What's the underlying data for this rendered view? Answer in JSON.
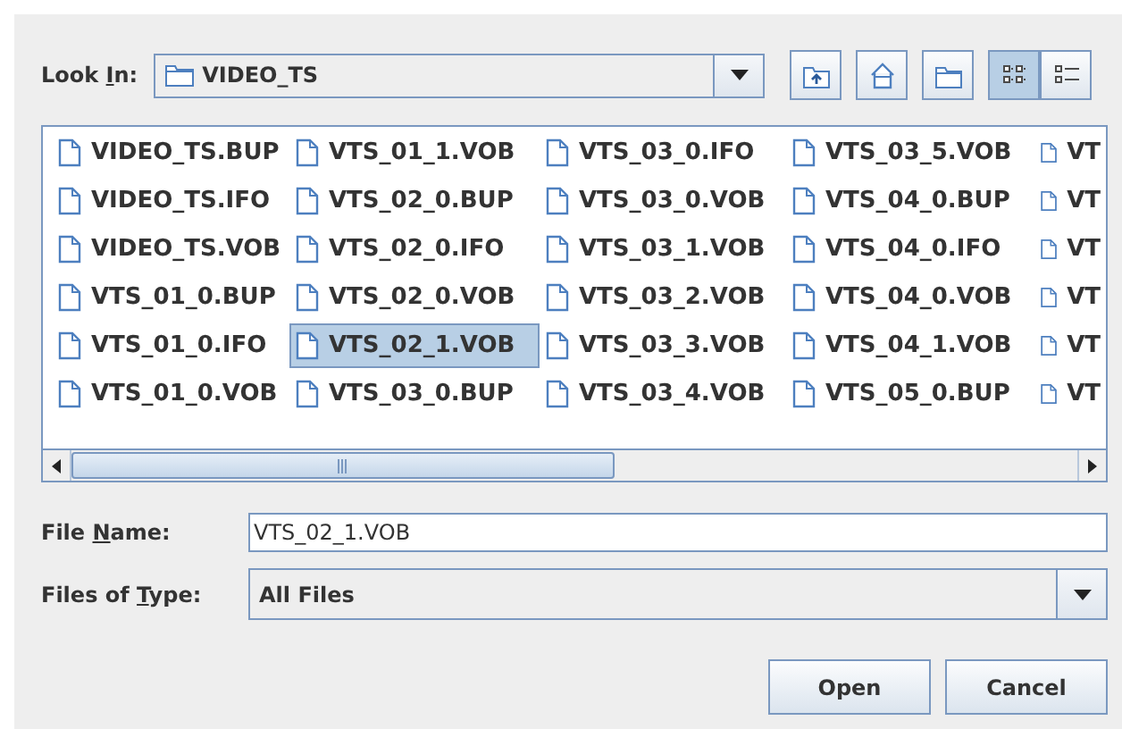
{
  "look_in": {
    "label": [
      {
        "text": "Look ",
        "underlined": false
      },
      {
        "text": "I",
        "underlined": true
      },
      {
        "text": "n:",
        "underlined": false
      }
    ],
    "value": "VIDEO_TS"
  },
  "toolbar": [
    {
      "kind": "up-folder",
      "selected": false
    },
    {
      "kind": "home",
      "selected": false
    },
    {
      "kind": "new-folder",
      "selected": false
    },
    {
      "kind": "list-view",
      "selected": true
    },
    {
      "kind": "details-view",
      "selected": false
    }
  ],
  "files": [
    {
      "name": "VIDEO_TS.BUP",
      "selected": false
    },
    {
      "name": "VIDEO_TS.IFO",
      "selected": false
    },
    {
      "name": "VIDEO_TS.VOB",
      "selected": false
    },
    {
      "name": "VTS_01_0.BUP",
      "selected": false
    },
    {
      "name": "VTS_01_0.IFO",
      "selected": false
    },
    {
      "name": "VTS_01_0.VOB",
      "selected": false
    },
    {
      "name": "VTS_01_1.VOB",
      "selected": false
    },
    {
      "name": "VTS_02_0.BUP",
      "selected": false
    },
    {
      "name": "VTS_02_0.IFO",
      "selected": false
    },
    {
      "name": "VTS_02_0.VOB",
      "selected": false
    },
    {
      "name": "VTS_02_1.VOB",
      "selected": true
    },
    {
      "name": "VTS_03_0.BUP",
      "selected": false
    },
    {
      "name": "VTS_03_0.IFO",
      "selected": false
    },
    {
      "name": "VTS_03_0.VOB",
      "selected": false
    },
    {
      "name": "VTS_03_1.VOB",
      "selected": false
    },
    {
      "name": "VTS_03_2.VOB",
      "selected": false
    },
    {
      "name": "VTS_03_3.VOB",
      "selected": false
    },
    {
      "name": "VTS_03_4.VOB",
      "selected": false
    },
    {
      "name": "VTS_03_5.VOB",
      "selected": false
    },
    {
      "name": "VTS_04_0.BUP",
      "selected": false
    },
    {
      "name": "VTS_04_0.IFO",
      "selected": false
    },
    {
      "name": "VTS_04_0.VOB",
      "selected": false
    },
    {
      "name": "VTS_04_1.VOB",
      "selected": false
    },
    {
      "name": "VTS_05_0.BUP",
      "selected": false
    },
    {
      "name": "VT",
      "selected": false
    },
    {
      "name": "VT",
      "selected": false
    },
    {
      "name": "VT",
      "selected": false
    },
    {
      "name": "VT",
      "selected": false
    },
    {
      "name": "VT",
      "selected": false
    },
    {
      "name": "VT",
      "selected": false
    }
  ],
  "file_name": {
    "label": [
      {
        "text": "File ",
        "underlined": false
      },
      {
        "text": "N",
        "underlined": true
      },
      {
        "text": "ame:",
        "underlined": false
      }
    ],
    "value": "VTS_02_1.VOB"
  },
  "files_of_type": {
    "label": [
      {
        "text": "Files of ",
        "underlined": false
      },
      {
        "text": "T",
        "underlined": true
      },
      {
        "text": "ype:",
        "underlined": false
      }
    ],
    "value": "All Files"
  },
  "buttons": [
    "Open",
    "Cancel"
  ]
}
